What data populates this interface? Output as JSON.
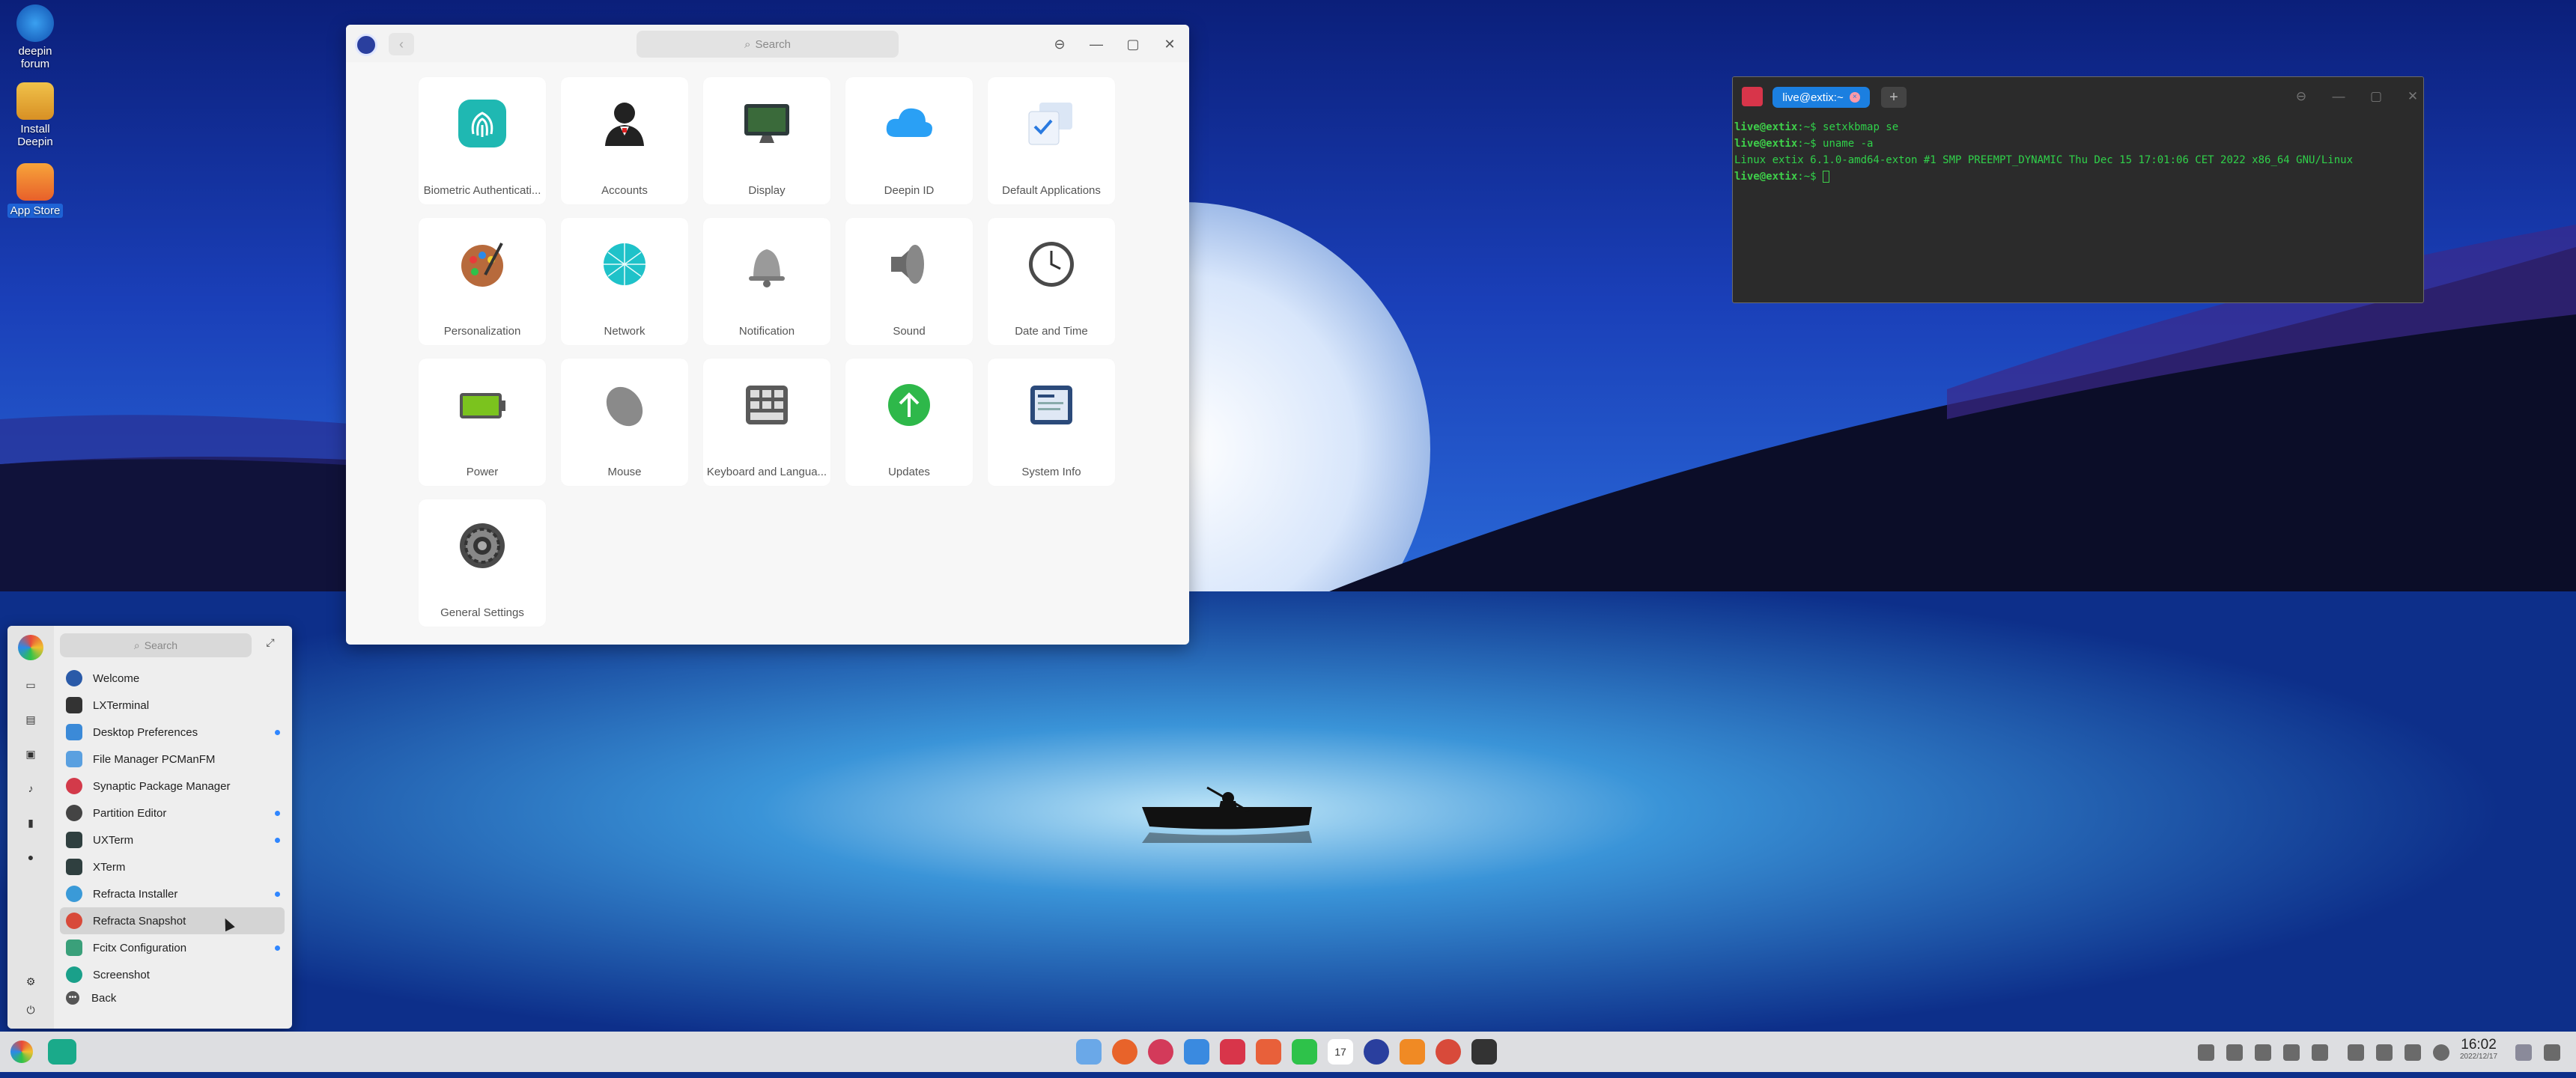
{
  "desktop": {
    "icons": [
      {
        "label": "deepin\nforum",
        "icon": "deepin-forum-icon"
      },
      {
        "label": "Install\nDeepin",
        "icon": "install-deepin-icon"
      },
      {
        "label": "App Store",
        "icon": "app-store-icon"
      }
    ]
  },
  "control_center": {
    "search_placeholder": "Search",
    "back_glyph": "‹",
    "window_buttons": [
      "⊖",
      "—",
      "▢",
      "✕"
    ],
    "modules": [
      {
        "label": "Biometric Authenticati...",
        "icon": "fingerprint-icon",
        "color": "#1fb8b2"
      },
      {
        "label": "Accounts",
        "icon": "account-icon",
        "color": "#222222"
      },
      {
        "label": "Display",
        "icon": "display-icon",
        "color": "#2d3a3a"
      },
      {
        "label": "Deepin ID",
        "icon": "cloud-icon",
        "color": "#2aa0f5"
      },
      {
        "label": "Default Applications",
        "icon": "default-apps-icon",
        "color": "#dbe6f5"
      },
      {
        "label": "Personalization",
        "icon": "palette-icon",
        "color": "#b76a3c"
      },
      {
        "label": "Network",
        "icon": "network-globe-icon",
        "color": "#1fc2c9"
      },
      {
        "label": "Notification",
        "icon": "bell-icon",
        "color": "#9a9a9a"
      },
      {
        "label": "Sound",
        "icon": "speaker-icon",
        "color": "#6a6a6a"
      },
      {
        "label": "Date and Time",
        "icon": "clock-icon",
        "color": "#4a4a4a"
      },
      {
        "label": "Power",
        "icon": "battery-icon",
        "color": "#7bc31e"
      },
      {
        "label": "Mouse",
        "icon": "mouse-icon",
        "color": "#8a8a8a"
      },
      {
        "label": "Keyboard and Langua...",
        "icon": "keyboard-icon",
        "color": "#5a5a5a"
      },
      {
        "label": "Updates",
        "icon": "update-arrow-icon",
        "color": "#2eb84a"
      },
      {
        "label": "System Info",
        "icon": "system-info-icon",
        "color": "#2b4a7a"
      },
      {
        "label": "General Settings",
        "icon": "gear-icon",
        "color": "#4a4a4a"
      }
    ]
  },
  "terminal": {
    "tab_label": "live@extix:~",
    "tab_close": "×",
    "new_tab": "+",
    "window_buttons": [
      "⊖",
      "—",
      "▢",
      "✕"
    ],
    "lines": [
      {
        "prompt": "live@extix",
        "path": ":~$ ",
        "cmd": "setxkbmap se",
        "output": ""
      },
      {
        "prompt": "live@extix",
        "path": ":~$ ",
        "cmd": "uname -a",
        "output": ""
      },
      {
        "prompt": "",
        "path": "",
        "cmd": "",
        "output": "Linux extix 6.1.0-amd64-exton #1 SMP PREEMPT_DYNAMIC Thu Dec 15 17:01:06 CET 2022 x86_64 GNU/Linux"
      },
      {
        "prompt": "live@extix",
        "path": ":~$ ",
        "cmd": "",
        "output": ""
      }
    ]
  },
  "launcher": {
    "search_placeholder": "Search",
    "expand_glyph": "⤢",
    "back_label": "Back",
    "items": [
      {
        "label": "Welcome",
        "icon": "welcome-icon",
        "color": "#2a5aa8",
        "dot": false,
        "highlight": false
      },
      {
        "label": "LXTerminal",
        "icon": "terminal-icon",
        "color": "#333333",
        "dot": false,
        "highlight": false
      },
      {
        "label": "Desktop Preferences",
        "icon": "desktop-prefs-icon",
        "color": "#3b8ad8",
        "dot": true,
        "highlight": false
      },
      {
        "label": "File Manager PCManFM",
        "icon": "file-manager-icon",
        "color": "#5aa0e0",
        "dot": false,
        "highlight": false
      },
      {
        "label": "Synaptic Package Manager",
        "icon": "synaptic-icon",
        "color": "#d33a4a",
        "dot": false,
        "highlight": false
      },
      {
        "label": "Partition Editor",
        "icon": "partition-icon",
        "color": "#444444",
        "dot": true,
        "highlight": false
      },
      {
        "label": "UXTerm",
        "icon": "uxterm-icon",
        "color": "#2f3f3f",
        "dot": true,
        "highlight": false
      },
      {
        "label": "XTerm",
        "icon": "xterm-icon",
        "color": "#2f3f3f",
        "dot": false,
        "highlight": false
      },
      {
        "label": "Refracta Installer",
        "icon": "refracta-installer-icon",
        "color": "#3a9ad8",
        "dot": true,
        "highlight": false
      },
      {
        "label": "Refracta Snapshot",
        "icon": "refracta-snapshot-icon",
        "color": "#d84a3a",
        "dot": false,
        "highlight": true
      },
      {
        "label": "Fcitx Configuration",
        "icon": "fcitx-icon",
        "color": "#3aa07a",
        "dot": true,
        "highlight": false
      },
      {
        "label": "Screenshot",
        "icon": "screenshot-icon",
        "color": "#1aa08a",
        "dot": false,
        "highlight": false
      }
    ],
    "side_icons": [
      "monitor-icon",
      "document-icon",
      "image-icon",
      "music-icon",
      "video-icon",
      "info-icon",
      "settings-icon",
      "power-icon"
    ]
  },
  "dock": {
    "apps": [
      {
        "name": "file-manager-dock-icon",
        "color": "#6aa8e8"
      },
      {
        "name": "firefox-dock-icon",
        "color": "#e8632a"
      },
      {
        "name": "synaptic-dock-icon",
        "color": "#d33a5a"
      },
      {
        "name": "control-center-dock-icon",
        "color": "#3a8ae0"
      },
      {
        "name": "terminal-dock-icon",
        "color": "#d8354a"
      },
      {
        "name": "image-viewer-dock-icon",
        "color": "#e8603a"
      },
      {
        "name": "music-dock-icon",
        "color": "#2ec24a"
      },
      {
        "name": "calendar-dock-icon",
        "color": "#ffffff"
      },
      {
        "name": "deepin-settings-dock-icon",
        "color": "#2a3f9e"
      },
      {
        "name": "app-store-dock-icon",
        "color": "#f08a24"
      },
      {
        "name": "refracta-dock-icon",
        "color": "#d84a3a"
      },
      {
        "name": "xterm-dock-icon",
        "color": "#333333"
      }
    ],
    "calendar_day": "17",
    "time": "16:02",
    "date": "2022/12/17"
  }
}
